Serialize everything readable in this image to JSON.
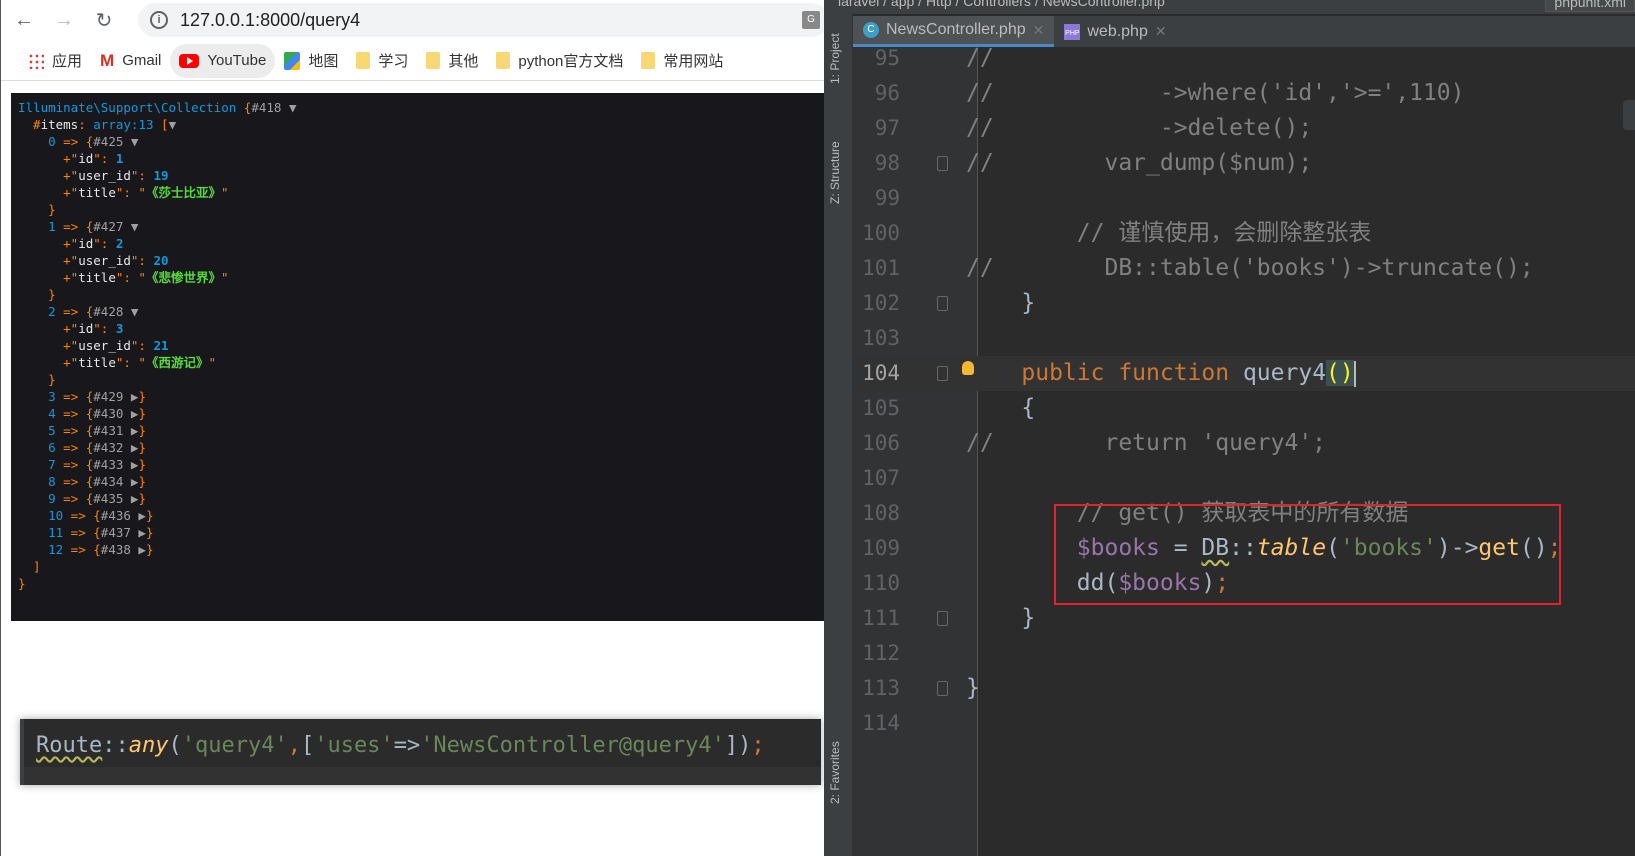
{
  "browser": {
    "url": "127.0.0.1:8000/query4",
    "bookmarks": [
      {
        "label": "应用",
        "icon": "apps-icon"
      },
      {
        "label": "Gmail",
        "icon": "gmail-icon"
      },
      {
        "label": "YouTube",
        "icon": "youtube-icon"
      },
      {
        "label": "地图",
        "icon": "maps-icon"
      },
      {
        "label": "学习",
        "icon": "folder-icon"
      },
      {
        "label": "其他",
        "icon": "folder-icon"
      },
      {
        "label": "python官方文档",
        "icon": "folder-icon"
      },
      {
        "label": "常用网站",
        "icon": "folder-icon"
      }
    ]
  },
  "dump": {
    "class": "Illuminate\\Support\\Collection",
    "id": "#418",
    "prop": "items",
    "count": "array:13",
    "expanded": [
      {
        "index": "0",
        "ref": "#425",
        "id": "1",
        "user_id": "19",
        "title": "《莎士比亚》"
      },
      {
        "index": "1",
        "ref": "#427",
        "id": "2",
        "user_id": "20",
        "title": "《悲惨世界》"
      },
      {
        "index": "2",
        "ref": "#428",
        "id": "3",
        "user_id": "21",
        "title": "《西游记》"
      }
    ],
    "collapsed": [
      [
        "3",
        "#429"
      ],
      [
        "4",
        "#430"
      ],
      [
        "5",
        "#431"
      ],
      [
        "6",
        "#432"
      ],
      [
        "7",
        "#433"
      ],
      [
        "8",
        "#434"
      ],
      [
        "9",
        "#435"
      ],
      [
        "10",
        "#436"
      ],
      [
        "11",
        "#437"
      ],
      [
        "12",
        "#438"
      ]
    ]
  },
  "route_snippet": [
    [
      "Route",
      "cls"
    ],
    [
      "::",
      "plain"
    ],
    [
      "any",
      "it"
    ],
    [
      "(",
      "plain"
    ],
    [
      "'query4'",
      "str"
    ],
    [
      ",",
      "semi"
    ],
    [
      "[",
      "plain"
    ],
    [
      "'uses'",
      "str"
    ],
    [
      "=>",
      "plain"
    ],
    [
      "'NewsController@query4'",
      "str"
    ],
    [
      "])",
      "plain"
    ],
    [
      ";",
      "semi"
    ]
  ],
  "ide": {
    "breadcrumb": "laravel / app / Http / Controllers / NewsController.php",
    "other_tab": "phpunit.xml",
    "side_tabs": [
      "1: Project",
      "Z: Structure",
      "2: Favorites"
    ],
    "tabs": [
      {
        "label": "NewsController.php",
        "active": true
      },
      {
        "label": "web.php",
        "active": false
      }
    ],
    "current_line": "104",
    "lines": [
      {
        "n": "95",
        "tok": [
          [
            "//",
            "cm"
          ]
        ]
      },
      {
        "n": "96",
        "tok": [
          [
            "//            ->where('id','>=',110)",
            "cm"
          ]
        ]
      },
      {
        "n": "97",
        "tok": [
          [
            "//            ->delete();",
            "cm"
          ]
        ]
      },
      {
        "n": "98",
        "fold": true,
        "tok": [
          [
            "//        var_dump($num);",
            "cm"
          ]
        ]
      },
      {
        "n": "99",
        "tok": []
      },
      {
        "n": "100",
        "tok": [
          [
            "        // 谨慎使用，会删除整张表",
            "cm"
          ]
        ]
      },
      {
        "n": "101",
        "tok": [
          [
            "//        DB::table('books')->truncate();",
            "cm"
          ]
        ]
      },
      {
        "n": "102",
        "fold": true,
        "tok": [
          [
            "    }",
            "plain"
          ]
        ]
      },
      {
        "n": "103",
        "tok": []
      },
      {
        "n": "104",
        "fold": true,
        "bulb": true,
        "tok": [
          [
            "    public function ",
            "kw"
          ],
          [
            "query4",
            "fn"
          ],
          [
            "()",
            "brace"
          ]
        ]
      },
      {
        "n": "105",
        "tok": [
          [
            "    {",
            "plain"
          ]
        ]
      },
      {
        "n": "106",
        "tok": [
          [
            "//        return 'query4';",
            "cm"
          ]
        ]
      },
      {
        "n": "107",
        "tok": []
      },
      {
        "n": "108",
        "tok": [
          [
            "        // get() 获取表中的所有数据",
            "cm"
          ]
        ]
      },
      {
        "n": "109",
        "tok": [
          [
            "        ",
            "plain"
          ],
          [
            "$books",
            "var"
          ],
          [
            " = ",
            "plain"
          ],
          [
            "DB",
            "cls"
          ],
          [
            "::",
            "plain"
          ],
          [
            "table",
            "it"
          ],
          [
            "(",
            "plain"
          ],
          [
            "'books'",
            "str"
          ],
          [
            ")->",
            "plain"
          ],
          [
            "get",
            "call"
          ],
          [
            "()",
            "plain"
          ],
          [
            ";",
            "semi"
          ]
        ]
      },
      {
        "n": "110",
        "tok": [
          [
            "        dd(",
            "plain"
          ],
          [
            "$books",
            "var"
          ],
          [
            ")",
            "plain"
          ],
          [
            ";",
            "semi"
          ]
        ]
      },
      {
        "n": "111",
        "fold": true,
        "tok": [
          [
            "    }",
            "plain"
          ]
        ]
      },
      {
        "n": "112",
        "tok": []
      },
      {
        "n": "113",
        "fold": true,
        "tok": [
          [
            "}",
            "plain"
          ]
        ]
      },
      {
        "n": "114",
        "tok": []
      }
    ]
  },
  "colors": {
    "highlight_box": "#e0232e",
    "editor_bg": "#2b2b2b",
    "dump_bg": "#18171b"
  }
}
